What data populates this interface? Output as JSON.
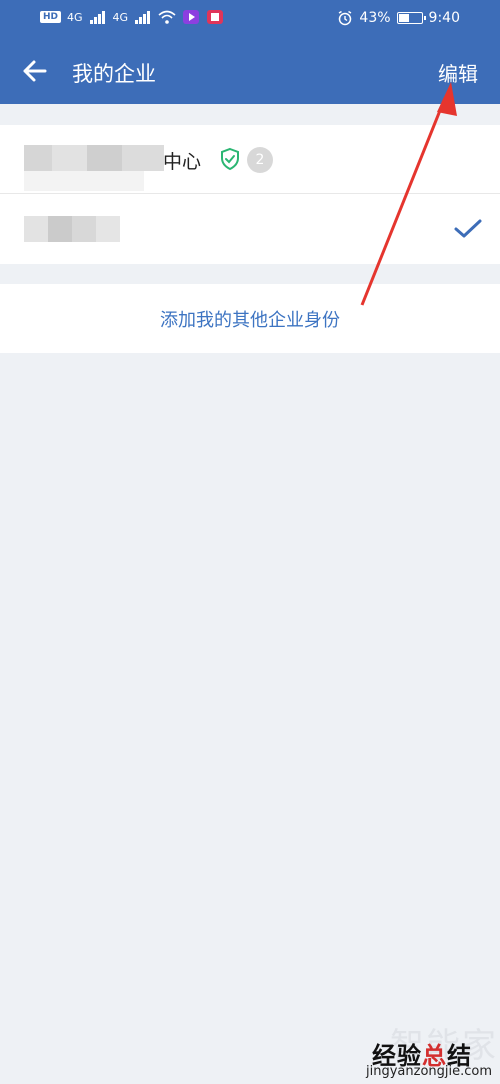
{
  "status_bar": {
    "left_badges": [
      "HD",
      "4G",
      "4G"
    ],
    "alarm_icon": "alarm-icon",
    "battery_percent": "43%",
    "battery_level": 0.43,
    "time": "9:40"
  },
  "header": {
    "back_icon": "back-arrow-icon",
    "title": "我的企业",
    "edit_label": "编辑",
    "background_color": "#3d6db8"
  },
  "companies": [
    {
      "name_visible_suffix": "中心",
      "verified": true,
      "badge_count": "2"
    },
    {
      "name_visible_suffix": "",
      "selected": true
    }
  ],
  "add_identity_link": "添加我的其他企业身份",
  "accent_color": "#3d74c2",
  "annotation_color": "#e5352e",
  "watermark": {
    "logo_text": "智能家",
    "main_prefix": "经验",
    "main_accent": "总",
    "main_suffix": "结",
    "url": "jingyanzongjie.com"
  }
}
